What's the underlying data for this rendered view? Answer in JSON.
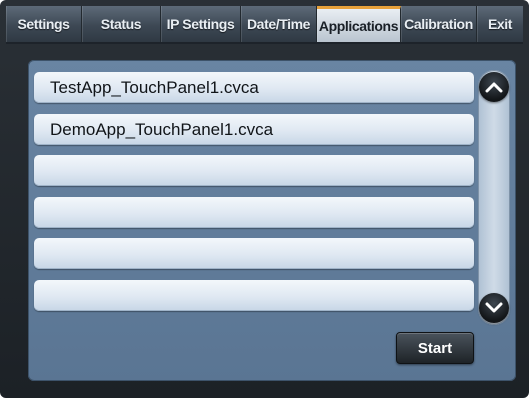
{
  "tabs": [
    {
      "label": "Settings"
    },
    {
      "label": "Status"
    },
    {
      "label": "IP Settings"
    },
    {
      "label": "Date/Time"
    },
    {
      "label": "Applications",
      "active": true
    },
    {
      "label": "Calibration"
    },
    {
      "label": "Exit"
    }
  ],
  "applications": {
    "list": [
      {
        "name": "TestApp_TouchPanel1.cvca"
      },
      {
        "name": "DemoApp_TouchPanel1.cvca"
      },
      {
        "name": ""
      },
      {
        "name": ""
      },
      {
        "name": ""
      },
      {
        "name": ""
      }
    ],
    "start_label": "Start"
  },
  "scrollbar": {
    "up_icon": "chevron-up-icon",
    "down_icon": "chevron-down-icon"
  },
  "colors": {
    "active_tab_accent": "#e7a13a",
    "panel": "#6985a3",
    "tabbar": "#3d4854"
  }
}
